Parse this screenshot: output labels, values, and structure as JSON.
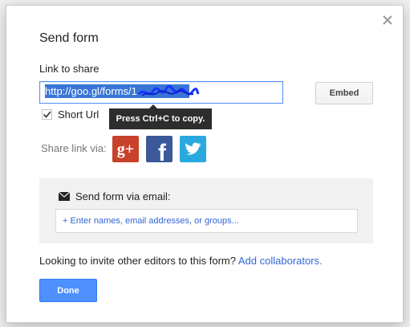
{
  "dialog": {
    "title": "Send form",
    "link_label": "Link to share",
    "url_value": "http://goo.gl/forms/1",
    "embed_label": "Embed",
    "short_url_label": "Short Url",
    "short_url_checked": true,
    "tooltip": "Press Ctrl+C to copy.",
    "share_label": "Share link via:",
    "social": [
      {
        "icon": "google-plus-icon",
        "glyph": "g+",
        "color": "#c8412b"
      },
      {
        "icon": "facebook-icon",
        "glyph": "f",
        "color": "#3b5998"
      },
      {
        "icon": "twitter-icon",
        "glyph": "t",
        "color": "#2aa9e0"
      }
    ],
    "email": {
      "title": "Send form via email:",
      "placeholder": "+ Enter names, email addresses, or groups..."
    },
    "invite_text": "Looking to invite other editors to this form?",
    "invite_link": "Add collaborators.",
    "done_label": "Done"
  },
  "colors": {
    "primary_button": "#4d90fe",
    "link": "#3367d6",
    "selection": "#3875d7"
  }
}
